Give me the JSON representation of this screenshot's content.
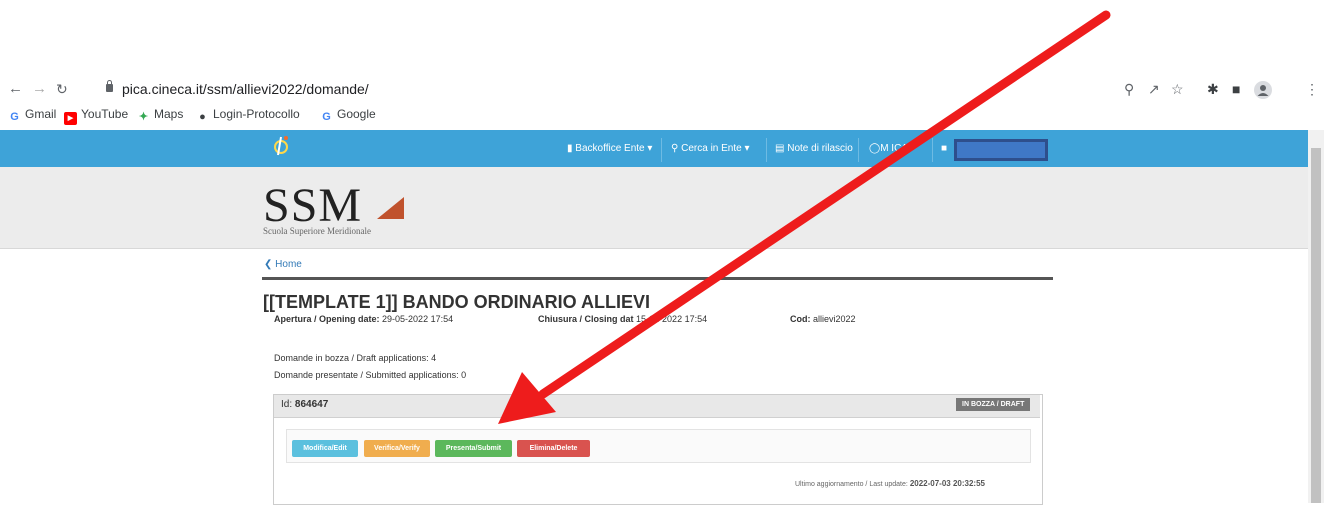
{
  "browser": {
    "url": "pica.cineca.it/ssm/allievi2022/domande/",
    "bookmarks": [
      "Gmail",
      "YouTube",
      "Maps",
      "Login-Protocollo",
      "Google"
    ]
  },
  "navbar": {
    "backoffice": "Backoffice Ente",
    "cerca": "Cerca in Ente",
    "note": "Note di rilascio",
    "help": "M    ICA"
  },
  "brand": {
    "name": "SSM",
    "subtitle": "Scuola Superiore Meridionale"
  },
  "breadcrumb": {
    "home": "Home"
  },
  "call": {
    "title": "[[TEMPLATE 1]] BANDO ORDINARIO ALLIEVI",
    "opening_label": "Apertura / Opening date:",
    "opening_value": "29-05-2022 17:54",
    "closing_label": "Chiusura / Closing dat",
    "closing_value": "15-12-2022 17:54",
    "cod_label": "Cod:",
    "cod_value": "allievi2022",
    "draft_apps": "Domande in bozza / Draft applications: 4",
    "submitted_apps": "Domande presentate / Submitted applications: 0"
  },
  "application": {
    "id_label": "Id:",
    "id_value": "864647",
    "status": "IN BOZZA / DRAFT",
    "buttons": {
      "edit": "Modifica/Edit",
      "verify": "Verifica/Verify",
      "submit": "Presenta/Submit",
      "delete": "Elimina/Delete"
    },
    "last_update_label": "Ultimo aggiornamento / Last update:",
    "last_update_value": "2022-07-03 20:32:55"
  },
  "colors": {
    "navbar": "#3ea3d8",
    "edit": "#5bc0de",
    "verify": "#f0ad4e",
    "submit": "#5cb85c",
    "delete": "#d9534f",
    "arrow": "#ee1c1c"
  },
  "icons": {
    "back": "arrow-left-icon",
    "forward": "arrow-right-icon",
    "reload": "reload-icon",
    "lock": "lock-icon",
    "search": "zoom-icon",
    "share": "share-icon",
    "star": "star-icon",
    "extensions": "puzzle-icon",
    "sidepanel": "side-panel-icon",
    "profile": "profile-icon",
    "menu": "kebab-menu-icon"
  }
}
